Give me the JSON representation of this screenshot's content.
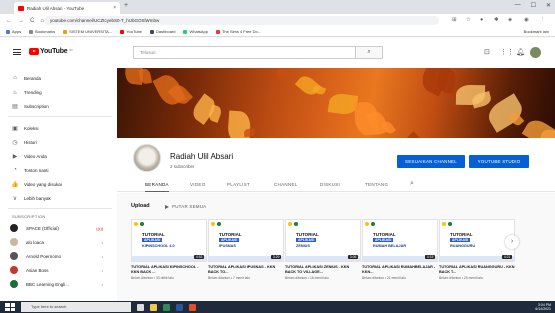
{
  "browser": {
    "tab_title": "Radiah Ulil Absari - YouTube",
    "tab_close": "×",
    "new_tab": "+",
    "url": "youtube.com/channel/UCZtcyebS0-T_hUbGOSlWmbw",
    "nav": {
      "back": "←",
      "forward": "→",
      "reload": "C",
      "home": "⌂"
    },
    "bookmarks": [
      {
        "label": "Apps",
        "color": "#4a7bd4"
      },
      {
        "label": "Bookmarks",
        "color": "#888888"
      },
      {
        "label": "SISTEM UNIVERSITA...",
        "color": "#e3a21a"
      },
      {
        "label": "YouTube",
        "color": "#ff0000"
      },
      {
        "label": "Dashboard",
        "color": "#3c4a5c"
      },
      {
        "label": "WhatsApp",
        "color": "#25d366"
      },
      {
        "label": "The Sims 4 Free Do...",
        "color": "#e03a3a"
      }
    ],
    "bookmarks_right": "Bookmark lain",
    "window_controls": [
      "—",
      "☐",
      "✕"
    ]
  },
  "youtube": {
    "logo_text": "YouTube",
    "logo_country": "ID",
    "search_placeholder": "Telusuri",
    "search_button": "⌕"
  },
  "sidebar": {
    "main": [
      {
        "label": "Beranda",
        "icon": "home-icon",
        "glyph": "⌂"
      },
      {
        "label": "Trending",
        "icon": "trending-icon",
        "glyph": "♨"
      },
      {
        "label": "Subscription",
        "icon": "subscriptions-icon",
        "glyph": "▤"
      }
    ],
    "library": [
      {
        "label": "Koleksi",
        "icon": "library-icon",
        "glyph": "▣"
      },
      {
        "label": "Histori",
        "icon": "history-icon",
        "glyph": "◷"
      },
      {
        "label": "Video Anda",
        "icon": "your-videos-icon",
        "glyph": "▶"
      },
      {
        "label": "Tonton nanti",
        "icon": "watch-later-icon",
        "glyph": "◔"
      },
      {
        "label": "Video yang disukai",
        "icon": "liked-videos-icon",
        "glyph": "👍"
      },
      {
        "label": "Lebih banyak",
        "icon": "show-more-icon",
        "glyph": "∨"
      }
    ],
    "subscription_heading": "SUBSCRIPTION",
    "subscriptions": [
      {
        "label": "SPACE (Official)",
        "color": "#222222",
        "extra": "live",
        "extra_text": "((•))"
      },
      {
        "label": "alo loaca",
        "color": "#c8b89a",
        "extra": "dot",
        "extra_text": "•"
      },
      {
        "label": "Arnold Poernomo",
        "color": "#555555",
        "extra": "dot",
        "extra_text": "•"
      },
      {
        "label": "Asian Boss",
        "color": "#c0392b",
        "extra": "dot",
        "extra_text": "•"
      },
      {
        "label": "BBC Learning Engli...",
        "color": "#1b6f3a",
        "extra": "dot",
        "extra_text": "•"
      }
    ]
  },
  "channel": {
    "name": "Radiah Ulil Absari",
    "subscribers": "2 subscriber",
    "customize_button": "SESUAIKAN CHANNEL",
    "studio_button": "YOUTUBE STUDIO",
    "tabs": [
      "BERANDA",
      "VIDEO",
      "PLAYLIST",
      "CHANNEL",
      "DISKUSI",
      "TENTANG"
    ],
    "active_tab": "BERANDA",
    "tab_search_glyph": "⌕"
  },
  "uploads": {
    "heading": "Upload",
    "play_all": "PUTAR SEMUA",
    "next_glyph": "›",
    "videos": [
      {
        "thumb_line1": "TUTORIAL",
        "thumb_line2": "APLIKASI",
        "thumb_line3": "KIPINSCHOOL 4.0",
        "duration": "4:53",
        "title": "TUTORIAL APLIKASI KIPINSCHOOL - KKN BACK ...",
        "meta": "Belum ditonton • 33 detik lalu"
      },
      {
        "thumb_line1": "TUTORIAL",
        "thumb_line2": "APLIKASI",
        "thumb_line3": "iPUSNAS",
        "duration": "3:29",
        "title": "TUTORIAL APLIKASI IPUSNAS - KKN BACK TO...",
        "meta": "Belum ditonton • 7 menit lalu"
      },
      {
        "thumb_line1": "TUTORIAL",
        "thumb_line2": "APLIKASI",
        "thumb_line3": "ZENIUS",
        "duration": "3:06",
        "title": "TUTORIAL APLIKASI ZENIUS - KKN BACK TO VILLAGE...",
        "meta": "Belum ditonton • 16 menit lalu"
      },
      {
        "thumb_line1": "TUTORIAL",
        "thumb_line2": "APLIKASI",
        "thumb_line3": "RUMAH BELAJAR",
        "duration": "4:15",
        "title": "TUTORIAL APLIKASI RUMAHBELAJAR - KKN...",
        "meta": "Belum ditonton • 21 menit lalu"
      },
      {
        "thumb_line1": "TUTORIAL",
        "thumb_line2": "APLIKASI",
        "thumb_line3": "RUANGGURU",
        "duration": "4:21",
        "title": "TUTORIAL APLIKASI RUANGGURU - KKN BACK T...",
        "meta": "Belum ditonton • 25 menit lalu"
      }
    ]
  },
  "taskbar": {
    "search_placeholder": "Type here to search",
    "time": "3:04 PM",
    "date": "6/14/2021"
  },
  "colors": {
    "accent": "#065fd4",
    "youtube_red": "#ff0000",
    "banner_orange": "#d9621a"
  }
}
